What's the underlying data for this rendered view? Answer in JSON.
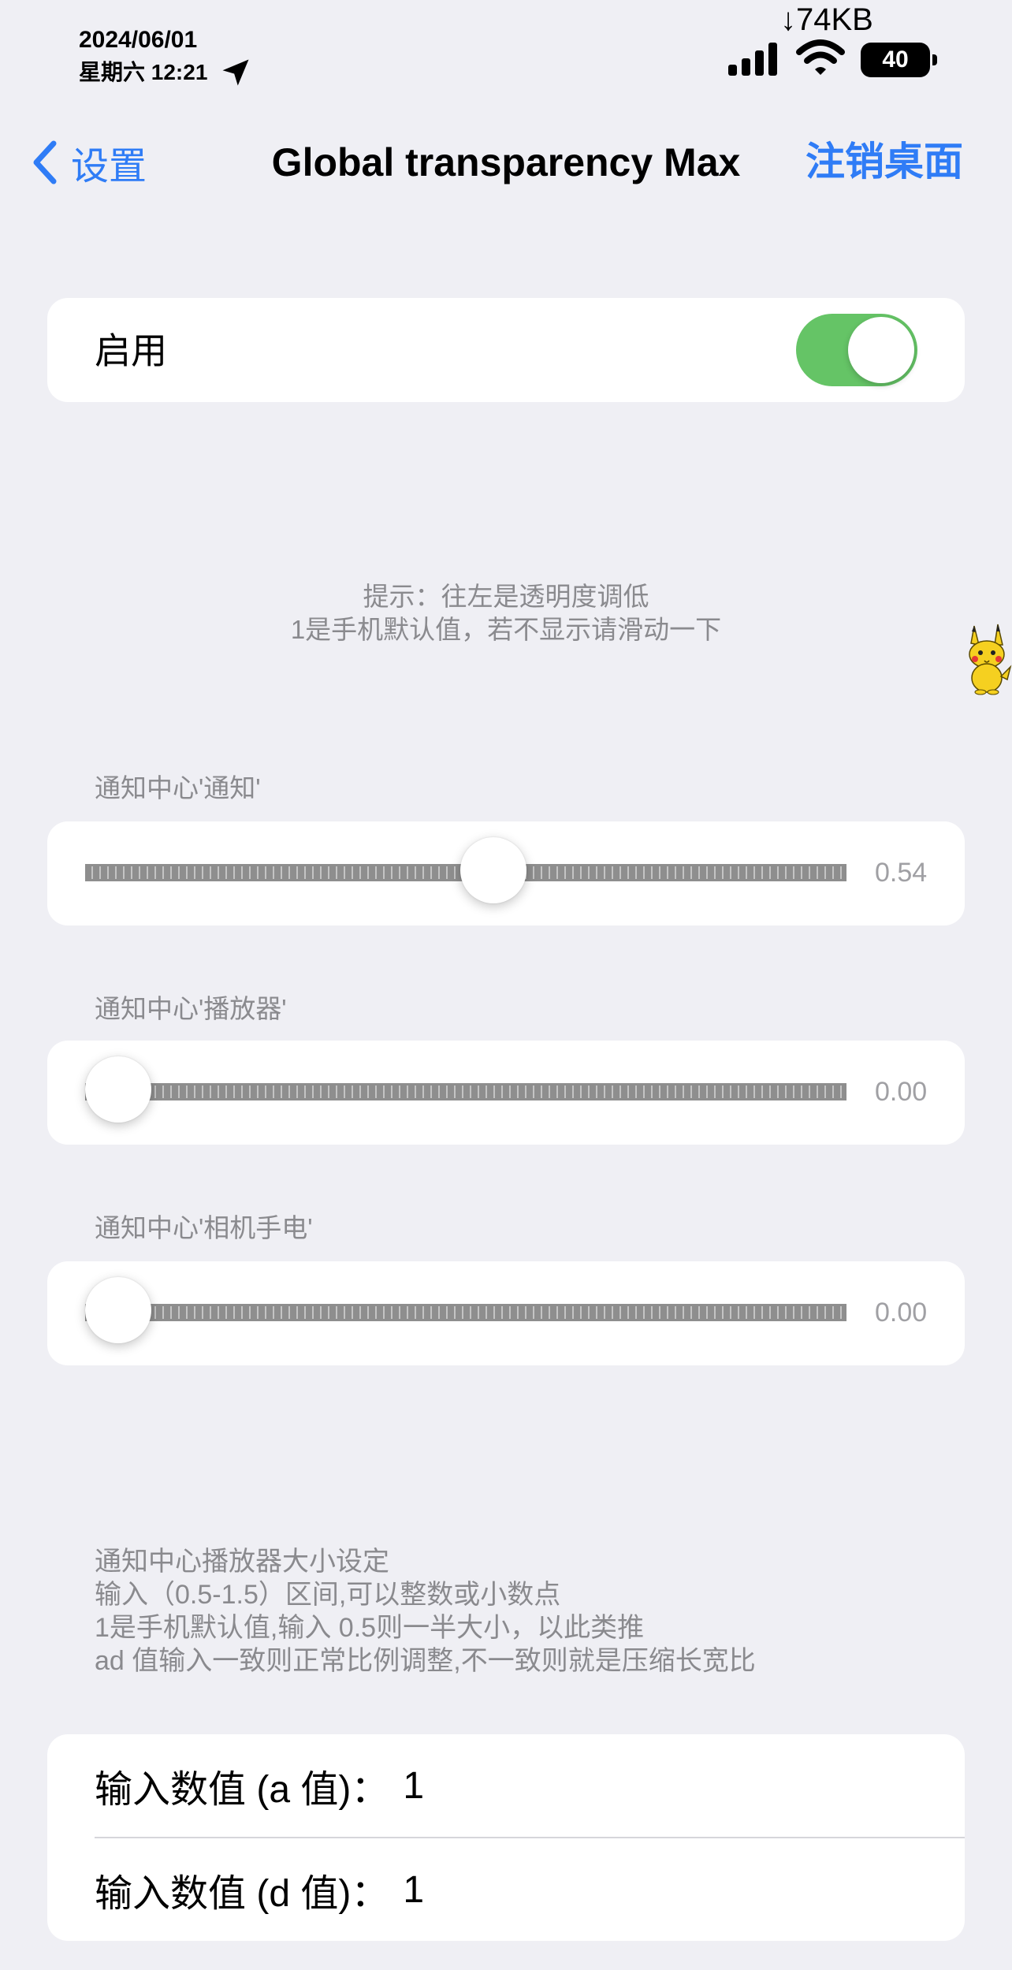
{
  "status_bar": {
    "date": "2024/06/01",
    "weekday_time": "星期六 12:21",
    "net_speed": "↓74KB",
    "battery": "40"
  },
  "nav": {
    "back_label": "设置",
    "title": "Global transparency Max",
    "action_label": "注销桌面",
    "accent_color": "#2f7cf6"
  },
  "enable": {
    "label": "启用",
    "on": true,
    "toggle_color": "#65c466"
  },
  "hint": {
    "line1": "提示：往左是透明度调低",
    "line2": "1是手机默认值，若不显示请滑动一下"
  },
  "sliders": [
    {
      "label": "通知中心'通知'",
      "value_text": "0.54",
      "value": 0.54,
      "min": 0,
      "max": 1
    },
    {
      "label": "通知中心'播放器'",
      "value_text": "0.00",
      "value": 0.0,
      "min": 0,
      "max": 1
    },
    {
      "label": "通知中心'相机手电'",
      "value_text": "0.00",
      "value": 0.0,
      "min": 0,
      "max": 1
    }
  ],
  "description": {
    "lines": [
      "通知中心播放器大小设定",
      "输入（0.5-1.5）区间,可以整数或小数点",
      "1是手机默认值,输入 0.5则一半大小，以此类推",
      "ad 值输入一致则正常比例调整,不一致则就是压缩长宽比"
    ]
  },
  "inputs": [
    {
      "label": "输入数值 (a 值)：",
      "value": "1"
    },
    {
      "label": "输入数值 (d 值)：",
      "value": "1"
    }
  ]
}
